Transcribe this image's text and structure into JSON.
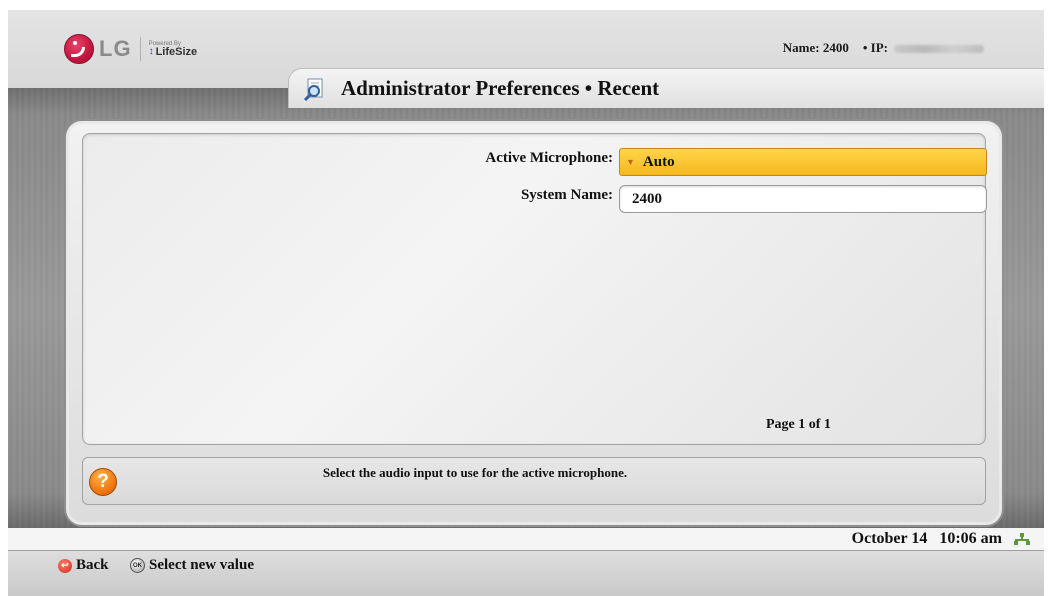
{
  "header": {
    "brand": "LG",
    "powered_by": "Powered By",
    "partner": "LifeSize",
    "system_name_label": "Name:",
    "system_name_value": "2400",
    "ip_label": "• IP:",
    "title": "Administrator Preferences • Recent"
  },
  "form": {
    "microphone_label": "Active Microphone:",
    "microphone_value": "Auto",
    "system_name_label": "System Name:",
    "system_name_value": "2400",
    "page_indicator": "Page 1 of 1"
  },
  "help": {
    "text": "Select the audio input to use for the active microphone."
  },
  "status": {
    "date": "October 14",
    "time": "10:06 am"
  },
  "footer": {
    "back_label": "Back",
    "ok_icon_text": "OK",
    "select_label": "Select new value"
  },
  "icons": {
    "logo": "lg-logo-icon",
    "title": "magnifier-document-icon",
    "help": "question-icon",
    "network": "network-icon",
    "back": "back-button-icon",
    "ok": "ok-button-icon",
    "dropdown": "dropdown-caret-icon"
  },
  "colors": {
    "dropdown_selected": "#f7b81e",
    "help_accent": "#f07a12",
    "brand": "#c2163f"
  }
}
